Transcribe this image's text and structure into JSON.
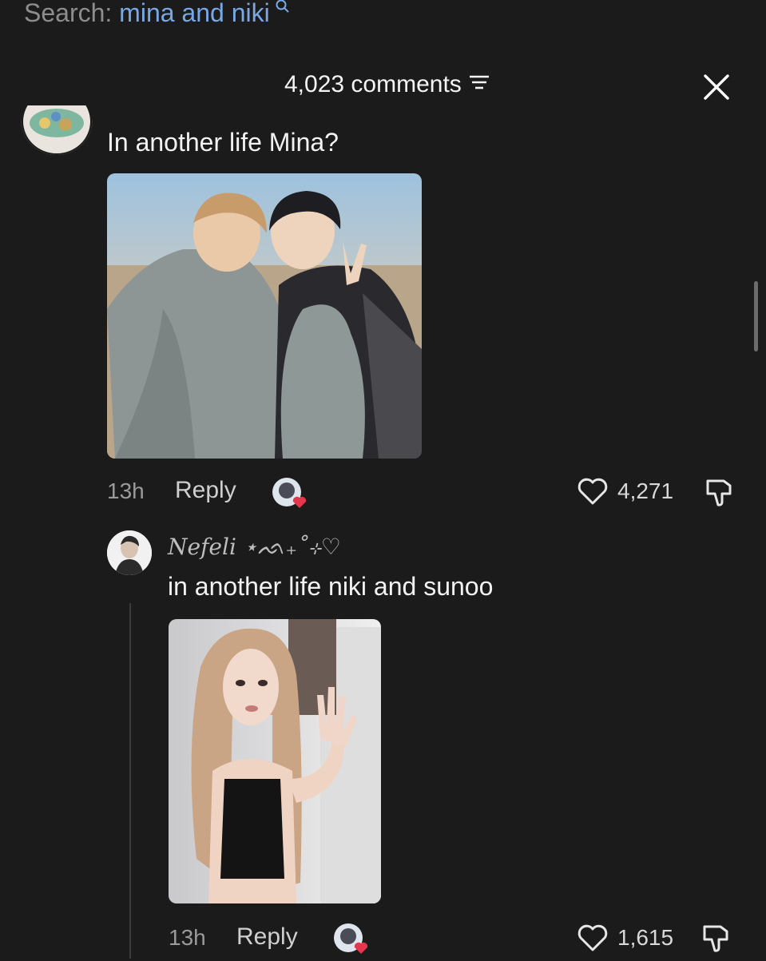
{
  "search": {
    "prefix": "Search: ",
    "query": "mina and niki"
  },
  "header": {
    "comments_count": "4,023 comments"
  },
  "comment1": {
    "text": "In another life Mina?",
    "time": "13h",
    "reply_label": "Reply",
    "likes": "4,271"
  },
  "comment2": {
    "username": "Nefeli ⋆ᨒ₊˚⊹♡",
    "text": "in another life niki and sunoo",
    "time": "13h",
    "reply_label": "Reply",
    "likes": "1,615"
  },
  "colors": {
    "background": "#1b1b1b",
    "link": "#79a8e6",
    "like_red": "#e5364b"
  },
  "icons": [
    "search-icon",
    "sort-icon",
    "close-icon",
    "heart-icon",
    "dislike-icon"
  ]
}
